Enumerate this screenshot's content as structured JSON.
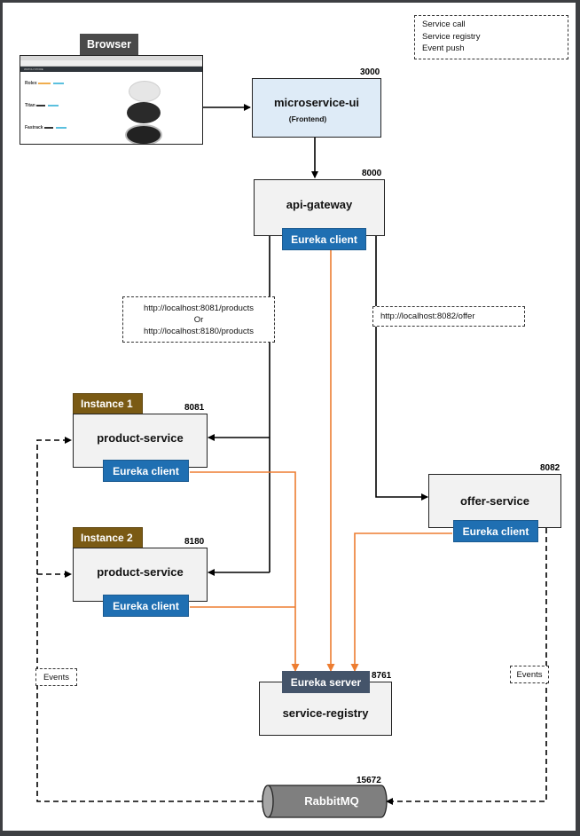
{
  "legend": {
    "items": [
      {
        "label": "Service call",
        "color": "#000000",
        "style": "solid"
      },
      {
        "label": "Service registry",
        "color": "#ed7d31",
        "style": "solid"
      },
      {
        "label": "Event push",
        "color": "#000000",
        "style": "dashed"
      }
    ]
  },
  "browser": {
    "label": "Browser",
    "screenshot": {
      "store_title": "WATCH STORE",
      "products": [
        "Rolex",
        "Titan",
        "Fastrack"
      ]
    }
  },
  "nodes": {
    "frontend": {
      "name": "microservice-ui",
      "subtitle": "(Frontend)",
      "port": "3000"
    },
    "gateway": {
      "name": "api-gateway",
      "port": "8000",
      "badge": "Eureka client"
    },
    "product1": {
      "name": "product-service",
      "port": "8081",
      "instance": "Instance 1",
      "badge": "Eureka client"
    },
    "product2": {
      "name": "product-service",
      "port": "8180",
      "instance": "Instance 2",
      "badge": "Eureka client"
    },
    "offer": {
      "name": "offer-service",
      "port": "8082",
      "badge": "Eureka client"
    },
    "registry": {
      "name": "service-registry",
      "port": "8761",
      "badge": "Eureka server"
    },
    "rabbit": {
      "name": "RabbitMQ",
      "port": "15672"
    }
  },
  "notes": {
    "products_url_1": "http://localhost:8081/products",
    "products_or": "Or",
    "products_url_2": "http://localhost:8180/products",
    "offer_url": "http://localhost:8082/offer",
    "events_left": "Events",
    "events_right": "Events"
  },
  "colors": {
    "registry_line": "#ed7d31",
    "eureka_client": "#1f6fb2",
    "eureka_server": "#44546a",
    "instance": "#7a5a14",
    "frontend_fill": "#deebf7",
    "node_fill": "#f2f2f2"
  }
}
